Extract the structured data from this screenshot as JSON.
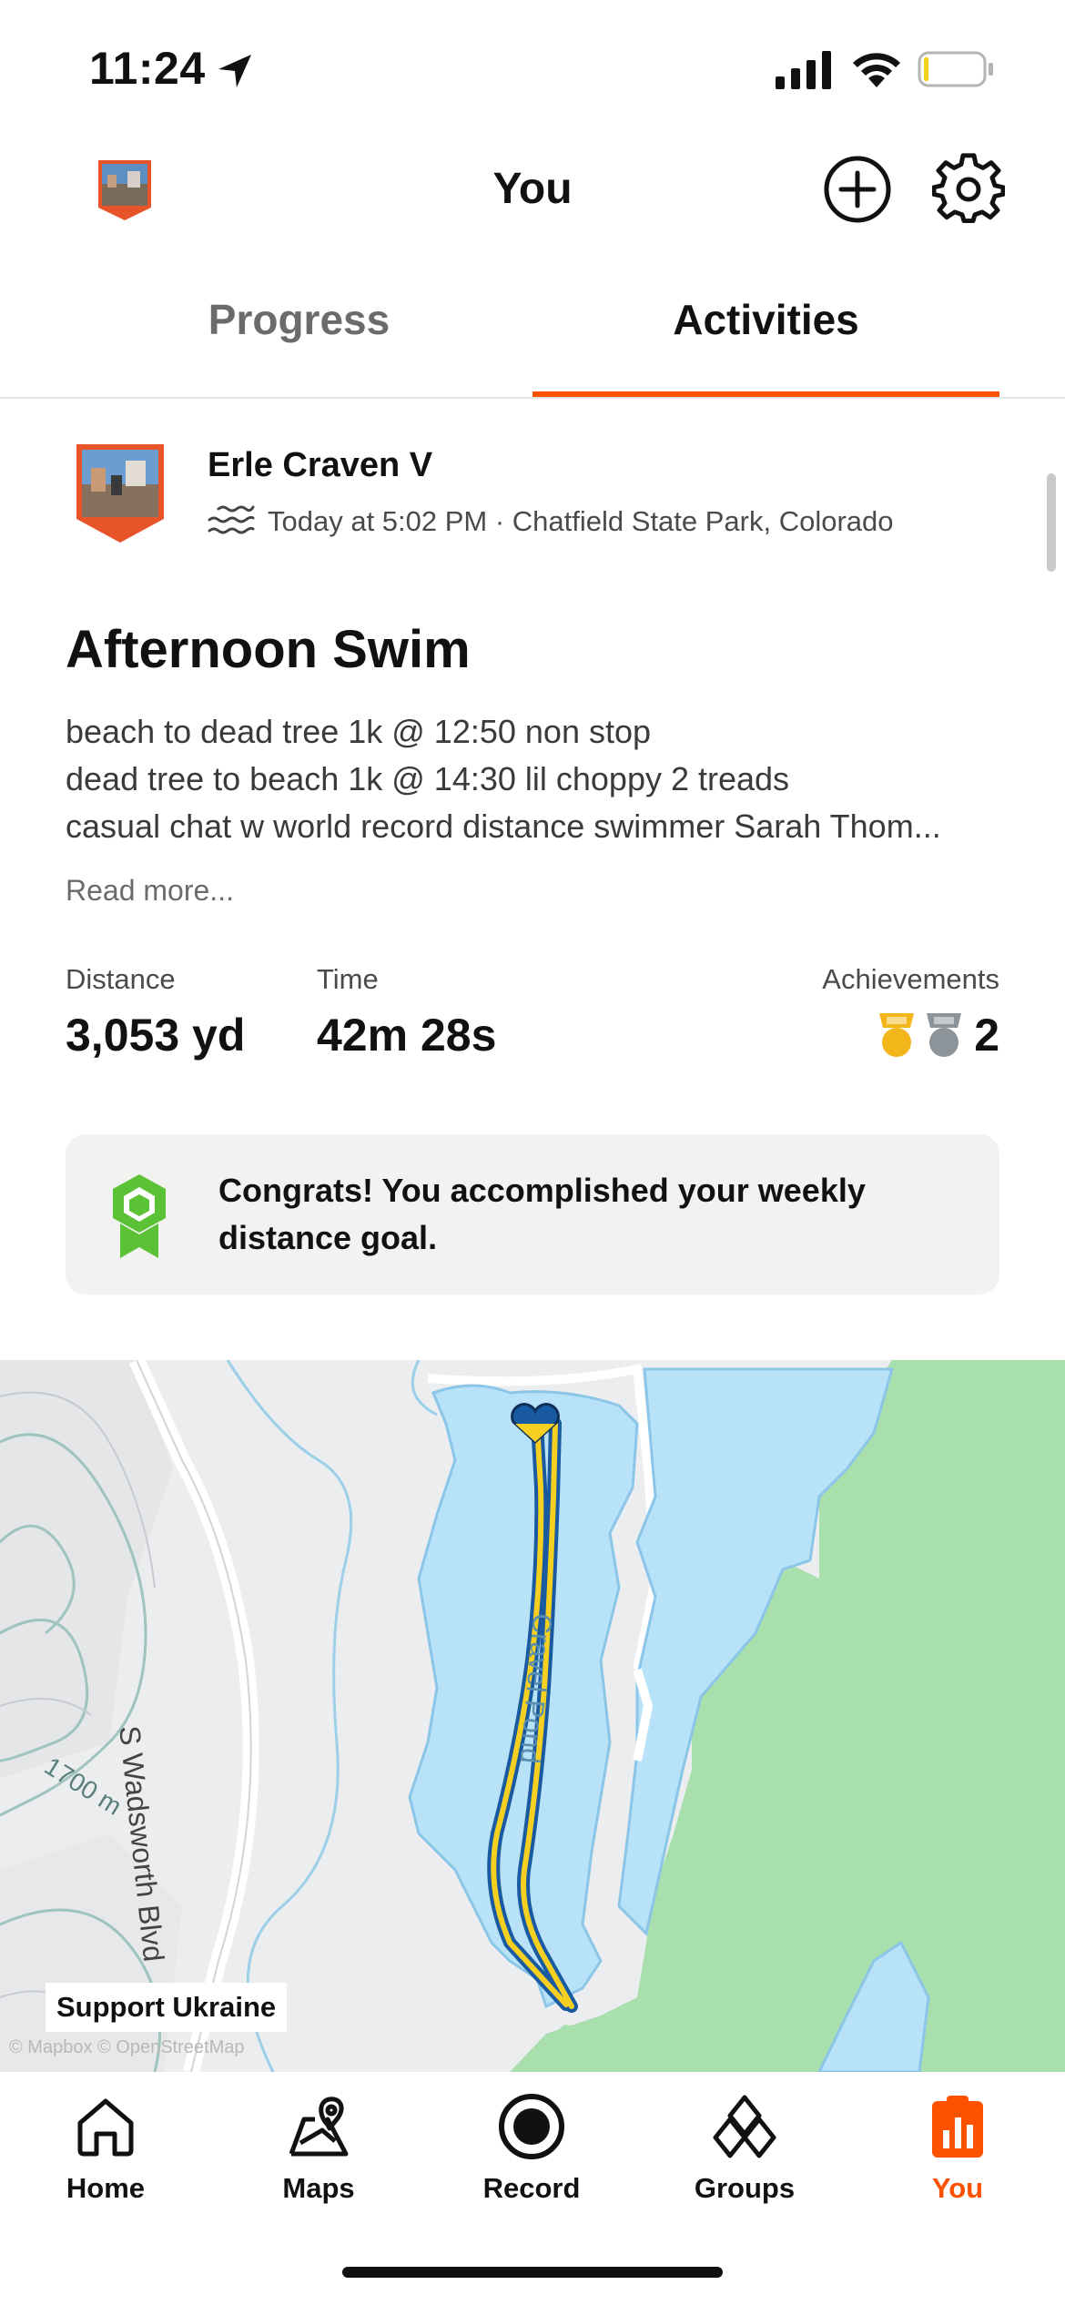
{
  "status_bar": {
    "time": "11:24"
  },
  "header": {
    "title": "You"
  },
  "tabs": [
    {
      "label": "Progress",
      "active": false
    },
    {
      "label": "Activities",
      "active": true
    }
  ],
  "activity": {
    "athlete_name": "Erle Craven V",
    "meta": "Today at 5:02 PM · Chatfield State Park, Colorado",
    "sport_icon": "swim-icon",
    "title": "Afternoon Swim",
    "description_lines": [
      "beach to dead tree 1k @ 12:50 non stop",
      "dead tree to beach 1k @ 14:30 lil choppy 2 treads",
      "casual chat w world record distance swimmer Sarah Thom..."
    ],
    "read_more": "Read more...",
    "stats": {
      "distance_label": "Distance",
      "distance_value": "3,053 yd",
      "time_label": "Time",
      "time_value": "42m 28s",
      "achievements_label": "Achievements",
      "achievements_count": "2"
    },
    "goal_message": "Congrats! You accomplished your weekly distance goal."
  },
  "map": {
    "road_label": "S Wadsworth Blvd",
    "contour_label": "1700 m",
    "pond_label": "Cravel Pond",
    "support_badge": "Support Ukraine",
    "attribution": "© Mapbox © OpenStreetMap"
  },
  "bottom_nav": [
    {
      "label": "Home",
      "icon": "home-icon"
    },
    {
      "label": "Maps",
      "icon": "maps-icon"
    },
    {
      "label": "Record",
      "icon": "record-icon"
    },
    {
      "label": "Groups",
      "icon": "groups-icon"
    },
    {
      "label": "You",
      "icon": "you-icon",
      "active": true
    }
  ],
  "colors": {
    "brand_orange": "#fc5200",
    "goal_green": "#5bc236",
    "water_blue": "#b8e2f8",
    "route_yellow": "#f5d020",
    "route_blue": "#1a5aa0",
    "gold_medal": "#f3b61a",
    "silver_medal": "#8c9399"
  }
}
